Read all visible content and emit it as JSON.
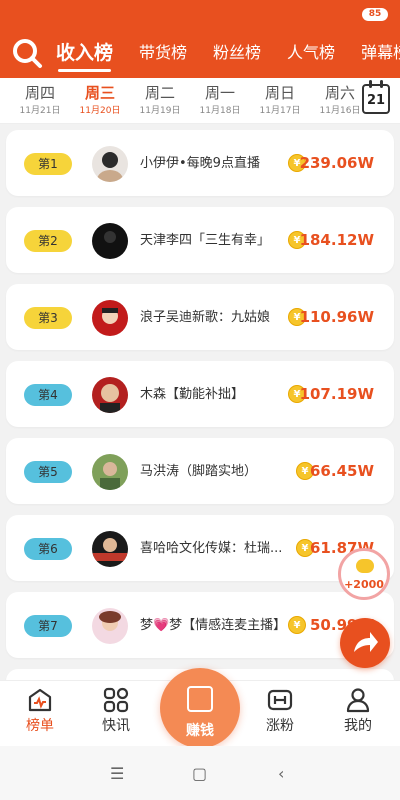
{
  "status": {
    "battery": "85"
  },
  "header": {
    "tabs": [
      {
        "label": "收入榜",
        "active": true
      },
      {
        "label": "带货榜"
      },
      {
        "label": "粉丝榜"
      },
      {
        "label": "人气榜"
      },
      {
        "label": "弹幕榜"
      }
    ]
  },
  "days": [
    {
      "weekday": "周四",
      "date": "11月21日"
    },
    {
      "weekday": "周三",
      "date": "11月20日",
      "active": true
    },
    {
      "weekday": "周二",
      "date": "11月19日"
    },
    {
      "weekday": "周一",
      "date": "11月18日"
    },
    {
      "weekday": "周日",
      "date": "11月17日"
    },
    {
      "weekday": "周六",
      "date": "11月16日"
    }
  ],
  "calendar": {
    "day": "21"
  },
  "ranking": [
    {
      "rank": "第1",
      "name": "小伊伊•每晚9点直播",
      "amount": "239.06W"
    },
    {
      "rank": "第2",
      "name": "天津李四「三生有幸」",
      "amount": "184.12W"
    },
    {
      "rank": "第3",
      "name": "浪子吴迪新歌：九姑娘",
      "amount": "110.96W"
    },
    {
      "rank": "第4",
      "name": "木森【勤能补拙】",
      "amount": "107.19W"
    },
    {
      "rank": "第5",
      "name": "马洪涛（脚踏实地）",
      "amount": "66.45W"
    },
    {
      "rank": "第6",
      "name": "喜哈哈文化传媒：杜瑞...",
      "amount": "61.87W"
    },
    {
      "rank": "第7",
      "name": "梦💗梦【情感连麦主播】",
      "amount": "50.99W"
    }
  ],
  "float_reward": {
    "text": "+2000"
  },
  "bottom_nav": {
    "items": [
      {
        "label": "榜单",
        "icon": "chart-icon",
        "active": true
      },
      {
        "label": "快讯",
        "icon": "grid-icon"
      },
      {
        "label": "赚钱",
        "icon": "gift-icon"
      },
      {
        "label": "涨粉",
        "icon": "dumbbell-icon"
      },
      {
        "label": "我的",
        "icon": "user-icon"
      }
    ]
  },
  "colors": {
    "accent": "#e8501f",
    "gold": "#f6d43a",
    "blue": "#56c0dd"
  }
}
